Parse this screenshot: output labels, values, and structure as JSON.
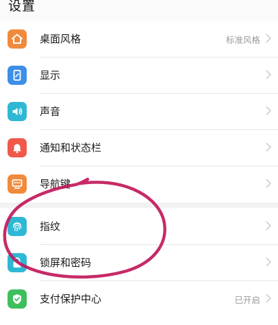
{
  "header": {
    "title": "设置"
  },
  "groups": [
    {
      "items": [
        {
          "label": "桌面风格",
          "value": "标准风格",
          "icon": "home-icon",
          "color": "#f08a3c"
        },
        {
          "label": "显示",
          "value": "",
          "icon": "display-icon",
          "color": "#3d8ee8"
        },
        {
          "label": "声音",
          "value": "",
          "icon": "speaker-icon",
          "color": "#2fb8d4"
        },
        {
          "label": "通知和状态栏",
          "value": "",
          "icon": "bell-icon",
          "color": "#f0594a"
        },
        {
          "label": "导航键",
          "value": "",
          "icon": "keyboard-icon",
          "color": "#f08a3c"
        }
      ]
    },
    {
      "items": [
        {
          "label": "指纹",
          "value": "",
          "icon": "fingerprint-icon",
          "color": "#2fb8d4"
        },
        {
          "label": "锁屏和密码",
          "value": "",
          "icon": "lock-icon",
          "color": "#2fb8d4"
        },
        {
          "label": "支付保护中心",
          "value": "已开启",
          "icon": "shield-icon",
          "color": "#3cbf5c"
        }
      ]
    }
  ],
  "colors": {
    "annotation": "#c2185b",
    "chevron": "#c8c8c8"
  }
}
